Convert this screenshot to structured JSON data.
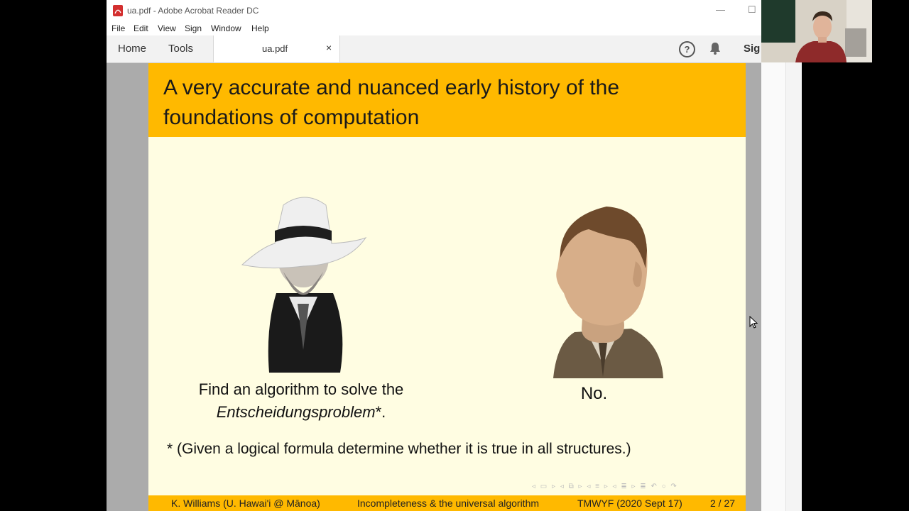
{
  "window": {
    "title": "ua.pdf - Adobe Acrobat Reader DC",
    "minimize": "—",
    "maximize": "☐"
  },
  "menu": [
    "File",
    "Edit",
    "View",
    "Sign",
    "Window",
    "Help"
  ],
  "tabs": {
    "home": "Home",
    "tools": "Tools",
    "document": "ua.pdf",
    "close": "×",
    "sign": "Sig"
  },
  "slide": {
    "title_line1": "A very accurate and nuanced early history of the",
    "title_line2": "foundations of computation",
    "left_caption_1": "Find an algorithm to solve the",
    "left_caption_2a": "Entscheidungsproblem",
    "left_caption_2b": "*.",
    "right_caption": "No.",
    "footnote": "* (Given a logical formula determine whether it is true in all structures.)",
    "nav_symbols": "◃ ▭ ▹ ◃ ⧉ ▹ ◃ ≡ ▹ ◃ ≣ ▹ ≣ ↶ ○ ↷"
  },
  "footer": {
    "author": "K. Williams (U. Hawai'i @ Mānoa)",
    "talk": "Incompleteness & the universal algorithm",
    "venue": "TMWYF (2020 Sept 17)",
    "page": "2 / 27"
  },
  "colors": {
    "header": "#ffb900",
    "slide_bg": "#fffde2",
    "viewer_bg": "#ababab"
  }
}
